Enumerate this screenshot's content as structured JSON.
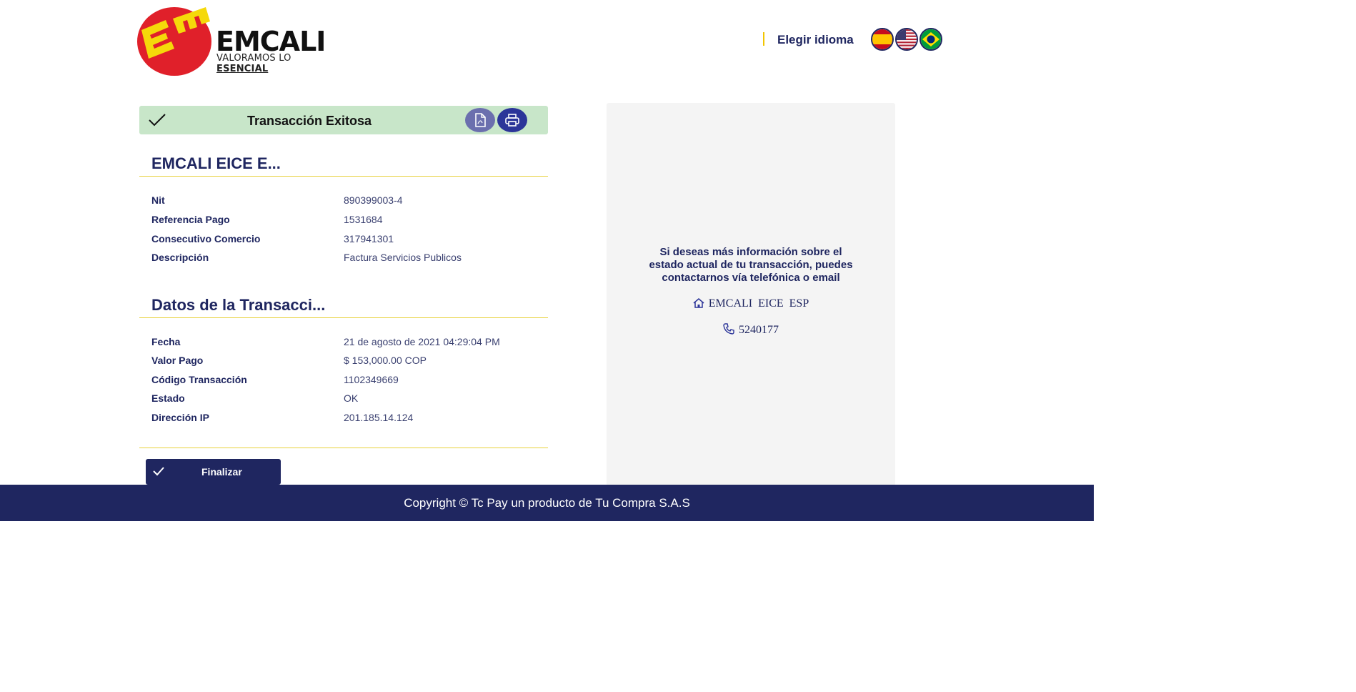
{
  "header": {
    "logo_name": "EMCALI",
    "logo_tagline_prefix": "VALORAMOS LO",
    "logo_tagline_emphasis": "ESENCIAL",
    "language_label": "Elegir idioma",
    "flags": [
      "spain-flag-icon",
      "usa-flag-icon",
      "brazil-flag-icon"
    ]
  },
  "banner": {
    "title": "Transacción Exitosa",
    "icons": [
      "check-icon",
      "pdf-icon",
      "print-icon"
    ]
  },
  "merchant": {
    "title": "EMCALI EICE E...",
    "rows": [
      {
        "label": "Nit",
        "value": "890399003-4"
      },
      {
        "label": "Referencia Pago",
        "value": "1531684"
      },
      {
        "label": "Consecutivo Comercio",
        "value": "317941301"
      },
      {
        "label": "Descripción",
        "value": "Factura Servicios Publicos"
      }
    ]
  },
  "transaction": {
    "title": "Datos de la Transacci...",
    "rows": [
      {
        "label": "Fecha",
        "value": "21 de agosto de 2021 04:29:04 PM"
      },
      {
        "label": "Valor Pago",
        "value": "$ 153,000.00 COP"
      },
      {
        "label": "Código Transacción",
        "value": "1102349669"
      },
      {
        "label": "Estado",
        "value": "OK"
      },
      {
        "label": "Dirección IP",
        "value": "201.185.14.124"
      }
    ]
  },
  "actions": {
    "finish_label": "Finalizar"
  },
  "info_panel": {
    "text": "Si deseas más información sobre el estado actual de tu transacción, puedes contactarnos vía telefónica o email",
    "company": "EMCALI  EICE  ESP",
    "phone": "5240177"
  },
  "footer": {
    "copyright": "Copyright © Tc Pay un producto de Tu Compra S.A.S"
  },
  "colors": {
    "primary": "#1f2660",
    "success_bg": "#c8e6c9",
    "rule": "#e8d13b",
    "panel_bg": "#f4f4f4",
    "logo_red": "#e0202a",
    "logo_yellow": "#f5d90a"
  }
}
